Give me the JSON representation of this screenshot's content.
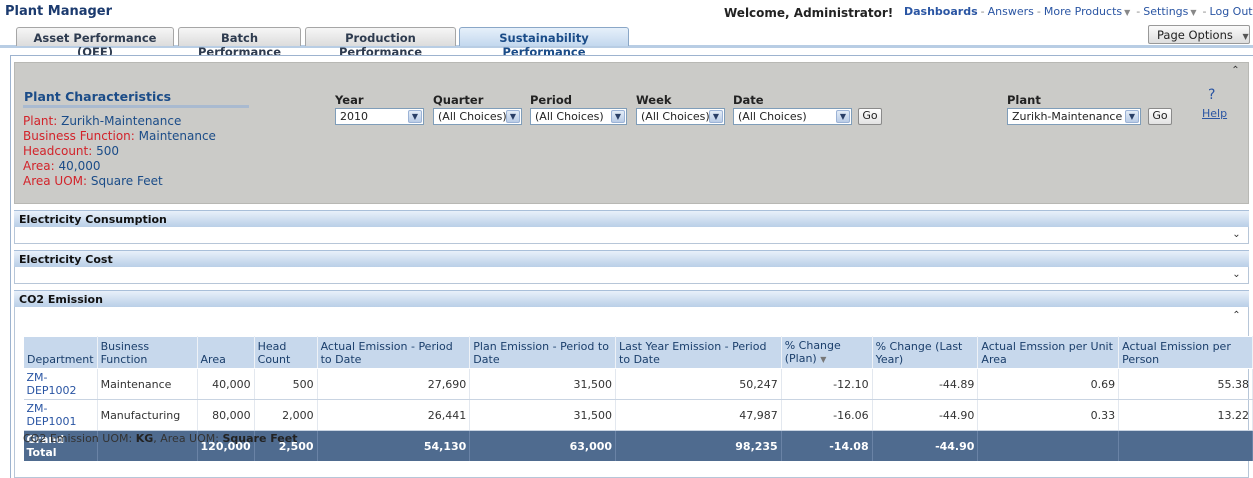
{
  "header": {
    "app_title": "Plant Manager",
    "welcome": "Welcome, Administrator!",
    "links": {
      "dashboards": "Dashboards",
      "answers": "Answers",
      "more_products": "More Products",
      "settings": "Settings",
      "logout": "Log Out",
      "separator": "-"
    }
  },
  "tabs": [
    {
      "label": "Asset Performance (OEE)",
      "active": false
    },
    {
      "label": "Batch Performance",
      "active": false
    },
    {
      "label": "Production Performance",
      "active": false
    },
    {
      "label": "Sustainability Performance",
      "active": true
    }
  ],
  "page_options_label": "Page Options",
  "plant_characteristics": {
    "title": "Plant Characteristics",
    "items": [
      {
        "key": "Plant:",
        "value": "Zurikh-Maintenance"
      },
      {
        "key": "Business Function:",
        "value": "Maintenance"
      },
      {
        "key": "Headcount:",
        "value": "500"
      },
      {
        "key": "Area:",
        "value": "40,000"
      },
      {
        "key": "Area UOM:",
        "value": "Square Feet"
      }
    ]
  },
  "prompts": {
    "year": {
      "label": "Year",
      "value": "2010"
    },
    "quarter": {
      "label": "Quarter",
      "value": "(All Choices)"
    },
    "period": {
      "label": "Period",
      "value": "(All Choices)"
    },
    "week": {
      "label": "Week",
      "value": "(All Choices)"
    },
    "date": {
      "label": "Date",
      "value": "(All Choices)"
    },
    "plant": {
      "label": "Plant",
      "value": "Zurikh-Maintenance"
    },
    "go_label": "Go",
    "help_symbol": "?",
    "help_label": "Help"
  },
  "sections": {
    "electricity_consumption": "Electricity Consumption",
    "electricity_cost": "Electricity Cost",
    "co2_emission": "CO2 Emission"
  },
  "co2_table": {
    "columns": [
      "Department",
      "Business Function",
      "Area",
      "Head Count",
      "Actual Emission - Period to Date",
      "Plan Emission - Period to Date",
      "Last Year Emission - Period to Date",
      "% Change (Plan)",
      "% Change (Last Year)",
      "Actual Emssion per Unit Area",
      "Actual Emission per Person"
    ],
    "rows": [
      [
        "ZM-DEP1002",
        "Maintenance",
        "40,000",
        "500",
        "27,690",
        "31,500",
        "50,247",
        "-12.10",
        "-44.89",
        "0.69",
        "55.38"
      ],
      [
        "ZM-DEP1001",
        "Manufacturing",
        "80,000",
        "2,000",
        "26,441",
        "31,500",
        "47,987",
        "-16.06",
        "-44.90",
        "0.33",
        "13.22"
      ]
    ],
    "total": [
      "Grand Total",
      "",
      "120,000",
      "2,500",
      "54,130",
      "63,000",
      "98,235",
      "-14.08",
      "-44.90",
      "",
      ""
    ]
  },
  "uom_note": {
    "co2_label": "CO2 Emission UOM:",
    "co2_value": "KG",
    "area_label": ", Area UOM:",
    "area_value": "Square Feet"
  }
}
